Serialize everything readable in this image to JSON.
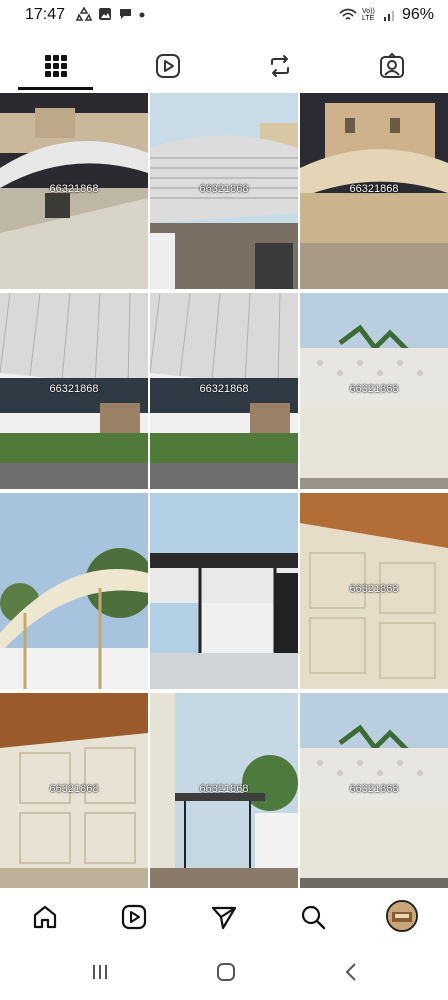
{
  "status": {
    "time": "17:47",
    "battery": "96%",
    "network": "Vo)) LTE"
  },
  "tabs": [
    {
      "name": "grid",
      "active": true
    },
    {
      "name": "reels",
      "active": false
    },
    {
      "name": "reposts",
      "active": false
    },
    {
      "name": "tagged",
      "active": false
    }
  ],
  "posts": [
    {
      "watermark": "66321868"
    },
    {
      "watermark": "66321868"
    },
    {
      "watermark": "66321868"
    },
    {
      "watermark": "66321868"
    },
    {
      "watermark": "66321868"
    },
    {
      "watermark": "66321868"
    },
    {
      "watermark": ""
    },
    {
      "watermark": ""
    },
    {
      "watermark": "66321868"
    },
    {
      "watermark": "66321868"
    },
    {
      "watermark": "66321868"
    },
    {
      "watermark": "66321868"
    }
  ],
  "bottom_nav": [
    "home-icon",
    "reels-icon",
    "send-icon",
    "search-icon",
    "profile-avatar"
  ],
  "system_nav": [
    "recents-icon",
    "home-icon",
    "back-icon"
  ]
}
